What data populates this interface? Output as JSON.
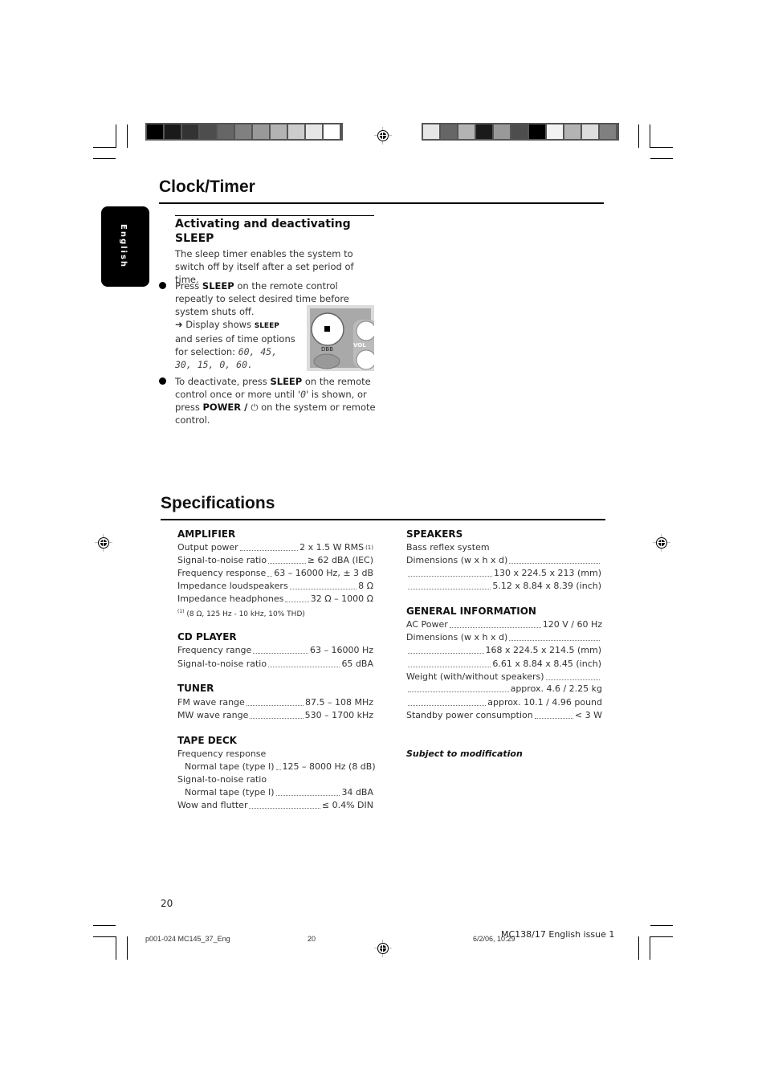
{
  "print_marks": {
    "left_strip_grays": [
      "#000000",
      "#1a1a1a",
      "#333333",
      "#4d4d4d",
      "#666666",
      "#808080",
      "#999999",
      "#b3b3b3",
      "#cccccc",
      "#e6e6e6",
      "#ffffff"
    ],
    "right_strip_grays": [
      "#e6e6e6",
      "#666666",
      "#b3b3b3",
      "#1a1a1a",
      "#999999",
      "#4d4d4d",
      "#000000",
      "#f2f2f2",
      "#b3b3b3",
      "#dddddd",
      "#808080"
    ]
  },
  "language_tab": "English",
  "clock_timer": {
    "title": "Clock/Timer",
    "subtitle": "Activating and deactivating SLEEP",
    "intro": "The sleep timer enables the system to switch off by itself after a set period of time.",
    "step1": {
      "pre": "Press ",
      "key": "SLEEP",
      "post": " on the remote control repeatly to select desired time before system shuts off.",
      "arrow": "➜",
      "display_pre": " Display shows ",
      "display_key": "SLEEP",
      "display_post": " and series of time options for selection: ",
      "options": "60, 45, 30, 15, 0, 60."
    },
    "step2": {
      "pre": "To deactivate, press ",
      "key": "SLEEP",
      "mid": " on the remote control once or more until '",
      "lcd": "0",
      "mid2": "' is shown, or press ",
      "key2": "POWER / ",
      "power_glyph": "⏻",
      "post": " on the system or remote control."
    },
    "image": {
      "button_label": "DBB",
      "side_label": "VOL"
    }
  },
  "specifications": {
    "title": "Specifications",
    "amplifier": {
      "heading": "AMPLIFIER",
      "rows": [
        {
          "label": "Output power",
          "value": "2 x 1.5 W RMS",
          "note": "(1)"
        },
        {
          "label": "Signal-to-noise ratio",
          "value": "≥ 62 dBA (IEC)"
        },
        {
          "label": "Frequency response",
          "value": "63 – 16000 Hz, ± 3 dB"
        },
        {
          "label": "Impedance loudspeakers",
          "value": "8 Ω"
        },
        {
          "label": "Impedance headphones",
          "value": "32 Ω – 1000 Ω"
        }
      ],
      "footnote_mark": "(1)",
      "footnote": "(8 Ω, 125 Hz - 10 kHz, 10% THD)"
    },
    "cd_player": {
      "heading": "CD PLAYER",
      "rows": [
        {
          "label": "Frequency range",
          "value": "63 – 16000 Hz"
        },
        {
          "label": "Signal-to-noise ratio",
          "value": "65 dBA"
        }
      ]
    },
    "tuner": {
      "heading": "TUNER",
      "rows": [
        {
          "label": "FM wave range",
          "value": "87.5 – 108 MHz"
        },
        {
          "label": "MW wave range",
          "value": "530 – 1700 kHz"
        }
      ]
    },
    "tape_deck": {
      "heading": "TAPE DECK",
      "freq_label": "Frequency response",
      "freq_row": {
        "label": "Normal tape (type I)",
        "value": "125 – 8000 Hz (8 dB)"
      },
      "snr_label": "Signal-to-noise ratio",
      "snr_row": {
        "label": "Normal tape (type I)",
        "value": "34 dBA"
      },
      "wow_row": {
        "label": "Wow and flutter",
        "value": "≤ 0.4% DIN"
      }
    },
    "speakers": {
      "heading": "SPEAKERS",
      "system": "Bass reflex system",
      "dim_label": "Dimensions (w x h x d)",
      "dim_mm": "130 x 224.5 x 213 (mm)",
      "dim_inch": "5.12 x 8.84 x 8.39 (inch)"
    },
    "general": {
      "heading": "GENERAL INFORMATION",
      "ac_row": {
        "label": "AC Power",
        "value": "120 V / 60 Hz"
      },
      "dim_label": "Dimensions (w x h x d)",
      "dim_mm": "168 x 224.5 x 214.5 (mm)",
      "dim_inch": "6.61 x 8.84 x 8.45 (inch)",
      "weight_label": "Weight (with/without speakers)",
      "weight_kg": "approx. 4.6 / 2.25 kg",
      "weight_lb": "approx. 10.1 / 4.96 pound",
      "standby_row": {
        "label": "Standby power consumption",
        "value": "< 3 W"
      }
    },
    "subject_note": "Subject to modification"
  },
  "footer": {
    "page_number": "20",
    "file_name": "p001-024 MC145_37_Eng",
    "slug_page": "20",
    "date": "6/2/06, 10:29",
    "issue": "MC138/17 English issue 1"
  }
}
